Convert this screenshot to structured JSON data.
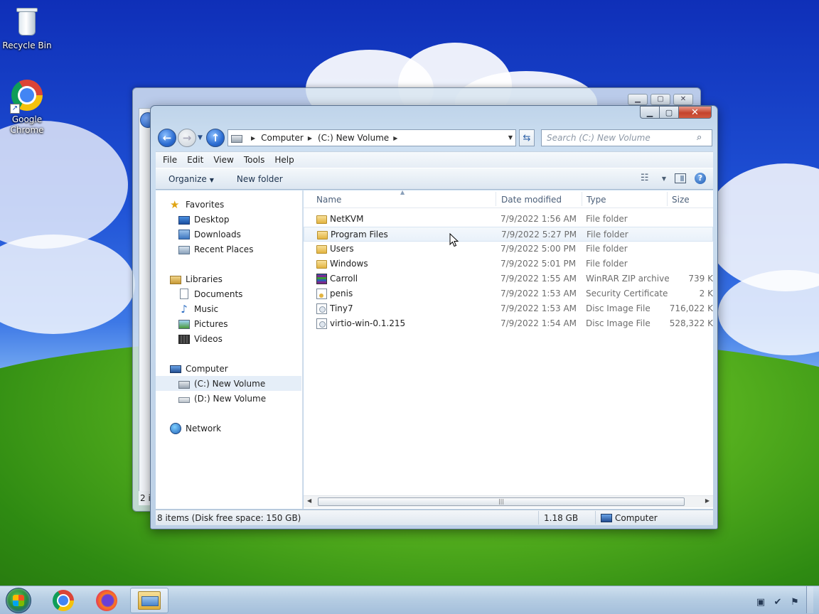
{
  "desktop": {
    "icons": [
      {
        "label": "Recycle Bin",
        "icon": "recycle-bin-icon"
      },
      {
        "label": "Google Chrome",
        "icon": "chrome-icon"
      }
    ]
  },
  "back_window": {
    "status_text": "2 it"
  },
  "explorer": {
    "address": {
      "crumbs": [
        "Computer",
        "(C:) New Volume"
      ]
    },
    "search": {
      "placeholder": "Search (C:) New Volume"
    },
    "menu": [
      "File",
      "Edit",
      "View",
      "Tools",
      "Help"
    ],
    "commands": {
      "organize": "Organize",
      "new_folder": "New folder"
    },
    "nav_pane": {
      "favorites": {
        "label": "Favorites",
        "items": [
          "Desktop",
          "Downloads",
          "Recent Places"
        ]
      },
      "libraries": {
        "label": "Libraries",
        "items": [
          "Documents",
          "Music",
          "Pictures",
          "Videos"
        ]
      },
      "computer": {
        "label": "Computer",
        "items": [
          "(C:) New Volume",
          "(D:) New Volume"
        ],
        "selected": "(C:) New Volume"
      },
      "network": {
        "label": "Network"
      }
    },
    "columns": {
      "name": "Name",
      "date": "Date modified",
      "type": "Type",
      "size": "Size"
    },
    "files": [
      {
        "name": "NetKVM",
        "date": "7/9/2022 1:56 AM",
        "type": "File folder",
        "size": "",
        "icon": "folder-icon"
      },
      {
        "name": "Program Files",
        "date": "7/9/2022 5:27 PM",
        "type": "File folder",
        "size": "",
        "icon": "folder-icon"
      },
      {
        "name": "Users",
        "date": "7/9/2022 5:00 PM",
        "type": "File folder",
        "size": "",
        "icon": "folder-icon"
      },
      {
        "name": "Windows",
        "date": "7/9/2022 5:01 PM",
        "type": "File folder",
        "size": "",
        "icon": "folder-icon"
      },
      {
        "name": "Carroll",
        "date": "7/9/2022 1:55 AM",
        "type": "WinRAR ZIP archive",
        "size": "739 K",
        "icon": "winrar-icon"
      },
      {
        "name": "penis",
        "date": "7/9/2022 1:53 AM",
        "type": "Security Certificate",
        "size": "2 K",
        "icon": "certificate-icon"
      },
      {
        "name": "Tiny7",
        "date": "7/9/2022 1:53 AM",
        "type": "Disc Image File",
        "size": "716,022 K",
        "icon": "disc-image-icon"
      },
      {
        "name": "virtio-win-0.1.215",
        "date": "7/9/2022 1:54 AM",
        "type": "Disc Image File",
        "size": "528,322 K",
        "icon": "disc-image-icon"
      }
    ],
    "hovered_row": "Program Files",
    "status": {
      "items": "8 items (Disk free space: 150 GB)",
      "size": "1.18 GB",
      "location": "Computer"
    }
  },
  "taskbar": {
    "buttons": [
      {
        "name": "Google Chrome",
        "icon": "chrome-icon"
      },
      {
        "name": "Firefox",
        "icon": "firefox-icon"
      },
      {
        "name": "Windows Explorer",
        "icon": "explorer-icon",
        "active": true
      }
    ]
  }
}
